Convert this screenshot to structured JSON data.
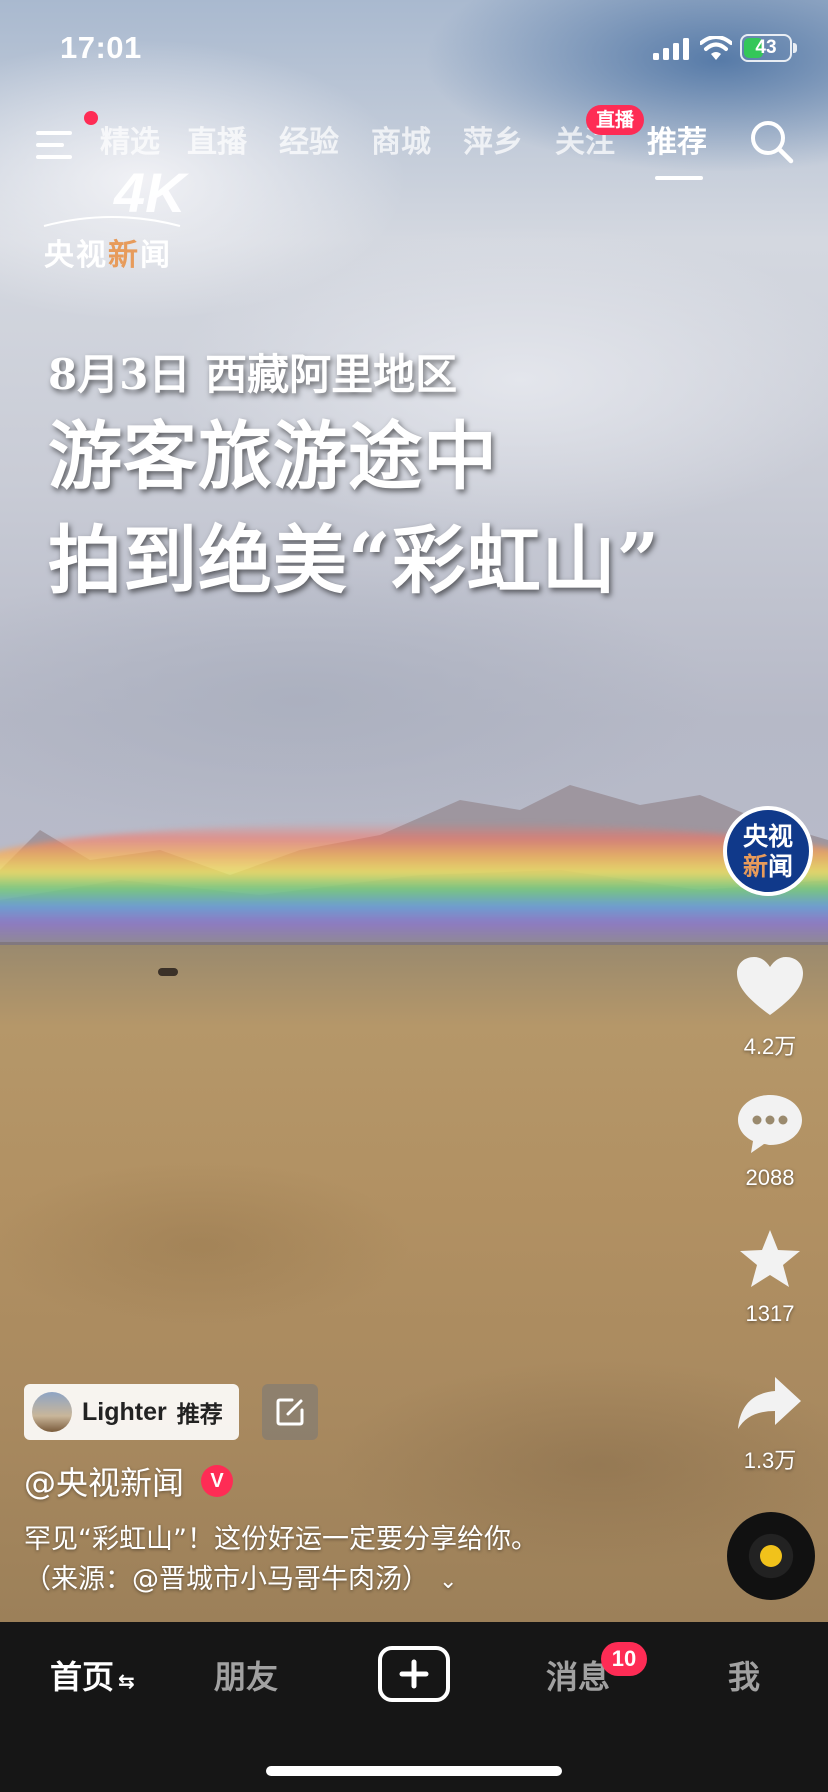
{
  "status_bar": {
    "time": "17:01",
    "battery": "43",
    "battery_level": 0.43
  },
  "top_nav": {
    "tabs": [
      "精选",
      "直播",
      "经验",
      "商城",
      "萍乡",
      "关注",
      "推荐"
    ],
    "active_tab": "推荐",
    "live_badge": "直播",
    "menu_has_notification": true
  },
  "watermark": {
    "badge": "4K",
    "brand_parts": [
      "央视",
      "新",
      "闻"
    ]
  },
  "video": {
    "headline_lines": [
      "8月3日  西藏阿里地区",
      "游客旅游途中",
      "拍到绝美“彩虹山”"
    ]
  },
  "actions": {
    "avatar_text": [
      "央视",
      "新",
      "闻"
    ],
    "likes": "4.2万",
    "comments": "2088",
    "favorites": "1317",
    "shares": "1.3万"
  },
  "recommendation": {
    "name": "Lighter",
    "tag": "推荐"
  },
  "caption": {
    "author": "@央视新闻",
    "verified_badge": "V",
    "description_line1": "罕见“彩虹山”！这份好运一定要分享给你。",
    "description_line2": "（来源：@晋城市小马哥牛肉汤）"
  },
  "bottom_nav": {
    "home": "首页",
    "friends": "朋友",
    "messages": "消息",
    "messages_badge": "10",
    "me": "我"
  },
  "colors": {
    "accent_red": "#fe2c55",
    "battery_green": "#34c759",
    "tabbar_bg": "#161616",
    "brand_orange": "#e79b5b"
  }
}
